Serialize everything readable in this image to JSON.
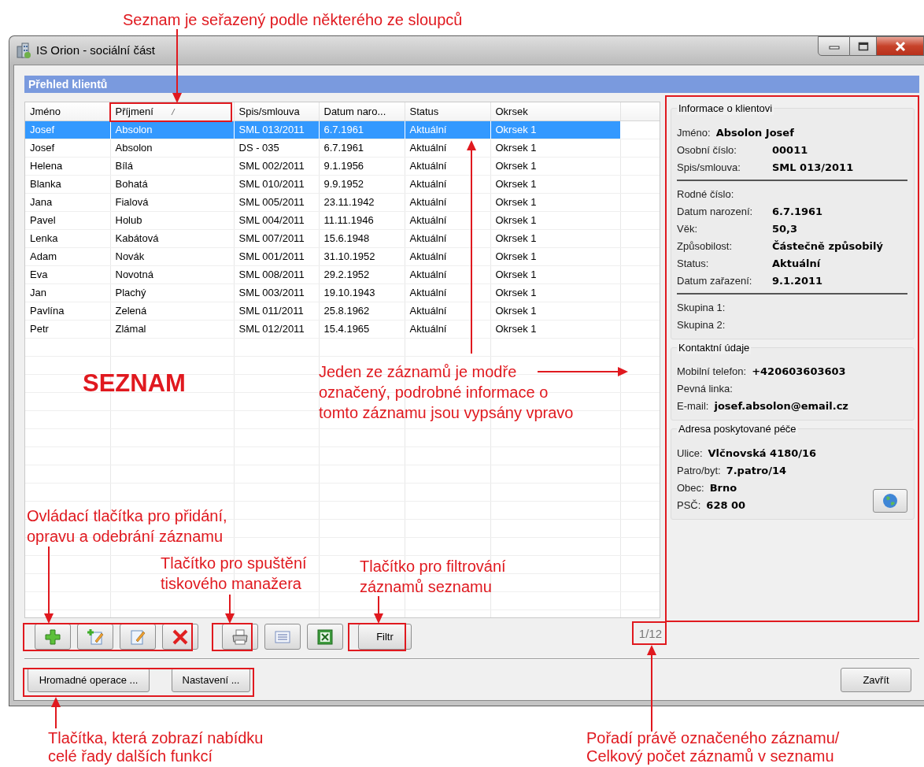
{
  "window": {
    "title": "IS Orion - sociální část"
  },
  "panel_title": "Přehled klientů",
  "table": {
    "columns": [
      {
        "label": "Jméno",
        "sorted": false
      },
      {
        "label": "Příjmení",
        "sorted": true
      },
      {
        "label": "Spis/smlouva",
        "sorted": false
      },
      {
        "label": "Datum naro...",
        "sorted": false
      },
      {
        "label": "Status",
        "sorted": false
      },
      {
        "label": "Okrsek",
        "sorted": false
      }
    ],
    "rows": [
      {
        "cells": [
          "Josef",
          "Absolon",
          "SML 013/2011",
          "6.7.1961",
          "Aktuální",
          "Okrsek 1"
        ],
        "selected": true
      },
      {
        "cells": [
          "Josef",
          "Absolon",
          "DS - 035",
          "6.7.1961",
          "Aktuální",
          "Okrsek 1"
        ],
        "selected": false
      },
      {
        "cells": [
          "Helena",
          "Bílá",
          "SML 002/2011",
          "9.1.1956",
          "Aktuální",
          "Okrsek 1"
        ],
        "selected": false
      },
      {
        "cells": [
          "Blanka",
          "Bohatá",
          "SML 010/2011",
          "9.9.1952",
          "Aktuální",
          "Okrsek 1"
        ],
        "selected": false
      },
      {
        "cells": [
          "Jana",
          "Fialová",
          "SML 005/2011",
          "23.11.1942",
          "Aktuální",
          "Okrsek 1"
        ],
        "selected": false
      },
      {
        "cells": [
          "Pavel",
          "Holub",
          "SML 004/2011",
          "11.11.1946",
          "Aktuální",
          "Okrsek 1"
        ],
        "selected": false
      },
      {
        "cells": [
          "Lenka",
          "Kabátová",
          "SML 007/2011",
          "15.6.1948",
          "Aktuální",
          "Okrsek 1"
        ],
        "selected": false
      },
      {
        "cells": [
          "Adam",
          "Novák",
          "SML 001/2011",
          "31.10.1952",
          "Aktuální",
          "Okrsek 1"
        ],
        "selected": false
      },
      {
        "cells": [
          "Eva",
          "Novotná",
          "SML 008/2011",
          "29.2.1952",
          "Aktuální",
          "Okrsek 1"
        ],
        "selected": false
      },
      {
        "cells": [
          "Jan",
          "Plachý",
          "SML 003/2011",
          "19.10.1943",
          "Aktuální",
          "Okrsek 1"
        ],
        "selected": false
      },
      {
        "cells": [
          "Pavlína",
          "Zelená",
          "SML 011/2011",
          "25.8.1962",
          "Aktuální",
          "Okrsek 1"
        ],
        "selected": false
      },
      {
        "cells": [
          "Petr",
          "Zlámal",
          "SML 012/2011",
          "15.4.1965",
          "Aktuální",
          "Okrsek 1"
        ],
        "selected": false
      }
    ]
  },
  "detail": [
    {
      "title": "Informace o klientovi",
      "groups": [
        {
          "kind": "inline",
          "divider": false,
          "fields": [
            {
              "label": "Jméno:",
              "value": "Absolon Josef"
            }
          ]
        },
        {
          "kind": "columns",
          "divider": true,
          "fields": [
            {
              "label": "Osobní číslo:",
              "value": "00011"
            },
            {
              "label": "Spis/smlouva:",
              "value": "SML 013/2011"
            }
          ]
        },
        {
          "kind": "columns",
          "divider": true,
          "fields": [
            {
              "label": "Rodné číslo:"
            },
            {
              "label": "Datum narození:",
              "value": "6.7.1961"
            },
            {
              "label": "Věk:",
              "value": "50,3"
            },
            {
              "label": "Způsobilost:",
              "value": "Částečně způsobilý"
            },
            {
              "label": "Status:",
              "value": "Aktuální"
            },
            {
              "label": "Datum zařazení:",
              "value": "9.1.2011"
            }
          ]
        },
        {
          "kind": "columns",
          "divider": false,
          "fields": [
            {
              "label": "Skupina 1:"
            },
            {
              "label": "Skupina 2:"
            }
          ]
        }
      ]
    },
    {
      "title": "Kontaktní údaje",
      "groups": [
        {
          "kind": "inline",
          "divider": false,
          "fields": [
            {
              "label": "Mobilní telefon:",
              "value": "+420603603603"
            },
            {
              "label": "Pevná linka:"
            },
            {
              "label": "E-mail:",
              "value": "josef.absolon@email.cz"
            }
          ]
        }
      ]
    },
    {
      "title": "Adresa poskytované péče",
      "map_button": true,
      "groups": [
        {
          "kind": "inline",
          "divider": false,
          "fields": [
            {
              "label": "Ulice:",
              "value": "Vlčnovská 4180/16"
            },
            {
              "label": "Patro/byt:",
              "value": "7.patro/14"
            },
            {
              "label": "Obec:",
              "value": "Brno"
            },
            {
              "label": "PSČ:",
              "value": "628 00"
            }
          ]
        }
      ]
    }
  ],
  "toolbar": [
    [
      {
        "kind": "add"
      },
      {
        "kind": "add-edit"
      },
      {
        "kind": "edit"
      },
      {
        "kind": "delete"
      }
    ],
    [
      {
        "kind": "print"
      },
      {
        "kind": "list"
      },
      {
        "kind": "export"
      }
    ],
    [
      {
        "kind": "text",
        "label": "Filtr"
      }
    ]
  ],
  "record_counter": "1/12",
  "bottom_buttons": [
    "Hromadné operace ...",
    "Nastavení ..."
  ],
  "close_button": "Zavřít",
  "annotations": [
    {
      "kind": "caption",
      "lines": [
        "Seznam je seřazený podle některého ze sloupců"
      ]
    },
    {
      "kind": "heading",
      "lines": [
        "SEZNAM"
      ]
    },
    {
      "kind": "caption",
      "lines": [
        "Jeden ze záznamů je modře",
        "označený, podrobné informace o",
        "tomto záznamu jsou vypsány vpravo"
      ]
    },
    {
      "kind": "caption",
      "lines": [
        "Ovládací tlačítka pro přidání,",
        "opravu a odebrání záznamu"
      ]
    },
    {
      "kind": "caption",
      "lines": [
        "Tlačítko pro spuštění",
        "tiskového manažera"
      ]
    },
    {
      "kind": "caption",
      "lines": [
        "Tlačítko pro filtrování",
        "záznamů seznamu"
      ]
    },
    {
      "kind": "caption",
      "lines": [
        "Tlačítka, která zobrazí nabídku",
        "celé řady dalších funkcí"
      ]
    },
    {
      "kind": "caption",
      "lines": [
        "Pořadí právě označeného záznamu/",
        "Celkový počet záznamů v seznamu"
      ]
    }
  ]
}
